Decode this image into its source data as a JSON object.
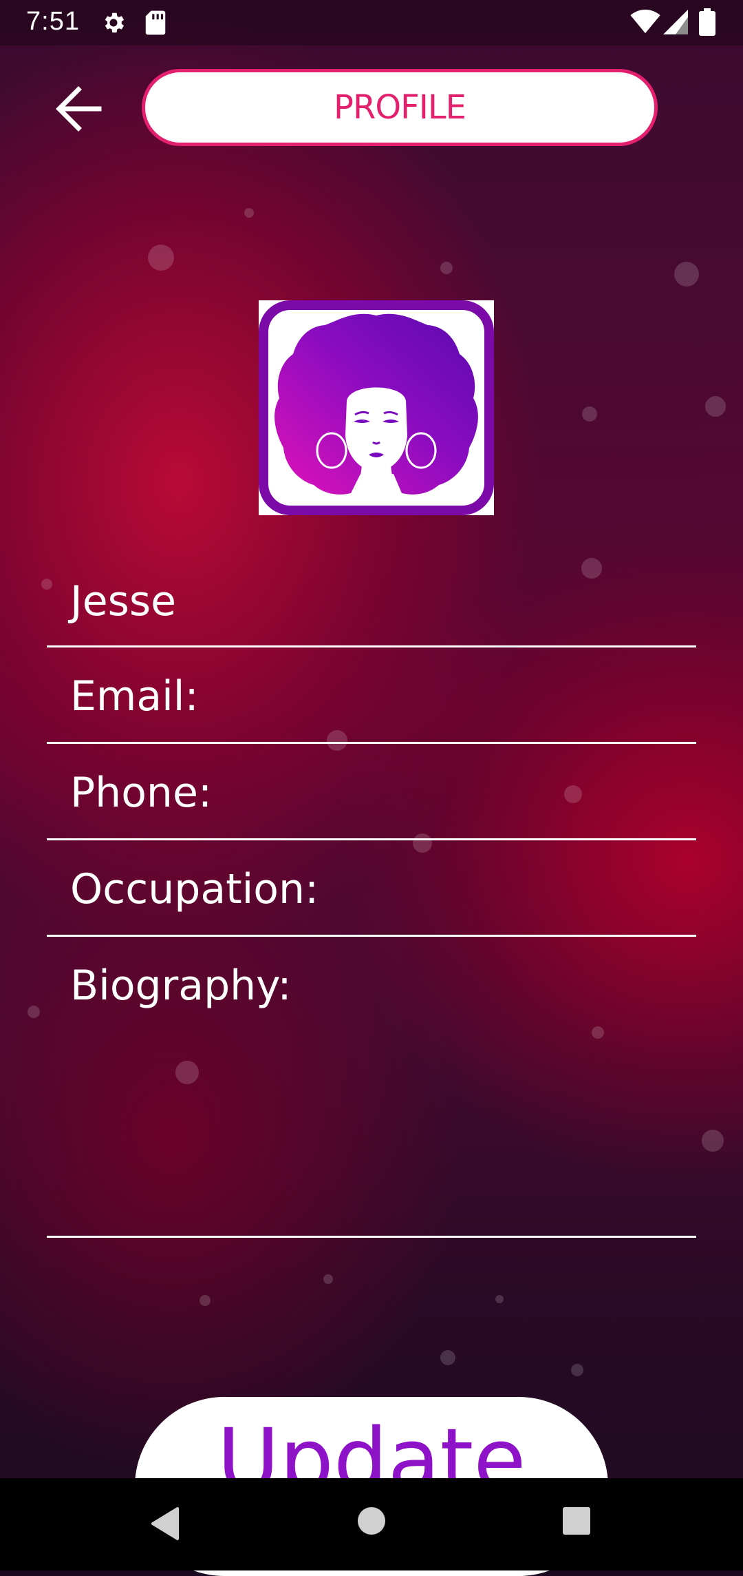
{
  "status_bar": {
    "time": "7:51"
  },
  "header": {
    "title": "PROFILE"
  },
  "form": {
    "name_value": "Jesse",
    "email_placeholder": "Email:",
    "phone_placeholder": "Phone:",
    "occupation_placeholder": "Occupation:",
    "biography_placeholder": "Biography:"
  },
  "actions": {
    "update_label": "Update"
  },
  "icons": {
    "back": "arrow-left-icon",
    "settings": "gear-icon",
    "sd_card": "sd-card-icon",
    "wifi": "wifi-icon",
    "signal": "signal-icon",
    "battery": "battery-icon",
    "nav_back": "nav-back-icon",
    "nav_home": "nav-home-icon",
    "nav_recents": "nav-recents-icon",
    "avatar": "afro-woman-avatar"
  },
  "colors": {
    "accent_pink": "#e2206e",
    "avatar_purple": "#7b0aa8",
    "update_text": "#8d12c8",
    "background_red": "#9a0532",
    "background_dark": "#1c0a20"
  }
}
